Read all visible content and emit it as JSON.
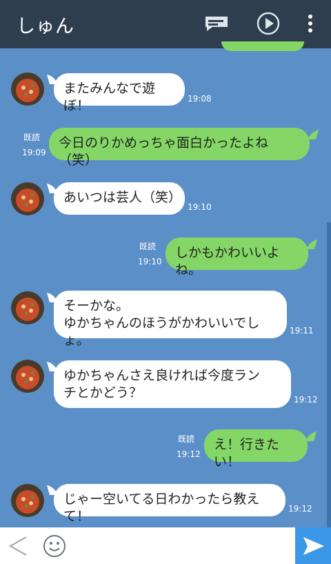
{
  "header": {
    "title": "しゅん"
  },
  "messages": [
    {
      "side": "left",
      "text": "またみんなで遊ぼ！",
      "time": "19:08"
    },
    {
      "side": "right",
      "text": "今日のりかめっちゃ面白かったよね（笑）",
      "time": "19:09",
      "read": "既読"
    },
    {
      "side": "left",
      "text": "あいつは芸人（笑）",
      "time": "19:10"
    },
    {
      "side": "right",
      "text": "しかもかわいいよね。",
      "time": "19:10",
      "read": "既読"
    },
    {
      "side": "left",
      "text": "そーかな。\nゆかちゃんのほうがかわいいでしょ。",
      "time": "19:11"
    },
    {
      "side": "left",
      "text": "ゆかちゃんさえ良ければ今度ラン\nチとかどう？",
      "time": "19:12"
    },
    {
      "side": "right",
      "text": "え！行きたい！",
      "time": "19:12",
      "read": "既読"
    },
    {
      "side": "left",
      "text": "じゃー空いてる日わかったら教えて！",
      "time": "19:12"
    }
  ],
  "icons": {
    "keyboard": "keyboard-icon",
    "play": "play-icon",
    "menu": "more-icon",
    "back": "chevron-left-icon",
    "emoji": "emoji-icon",
    "send": "send-icon",
    "avatar": "pizza-avatar"
  },
  "colors": {
    "header": "#2f3e4e",
    "background": "#5b8fc7",
    "sent_bubble": "#84d766",
    "received_bubble": "#ffffff",
    "send_button": "#3b97e8"
  }
}
